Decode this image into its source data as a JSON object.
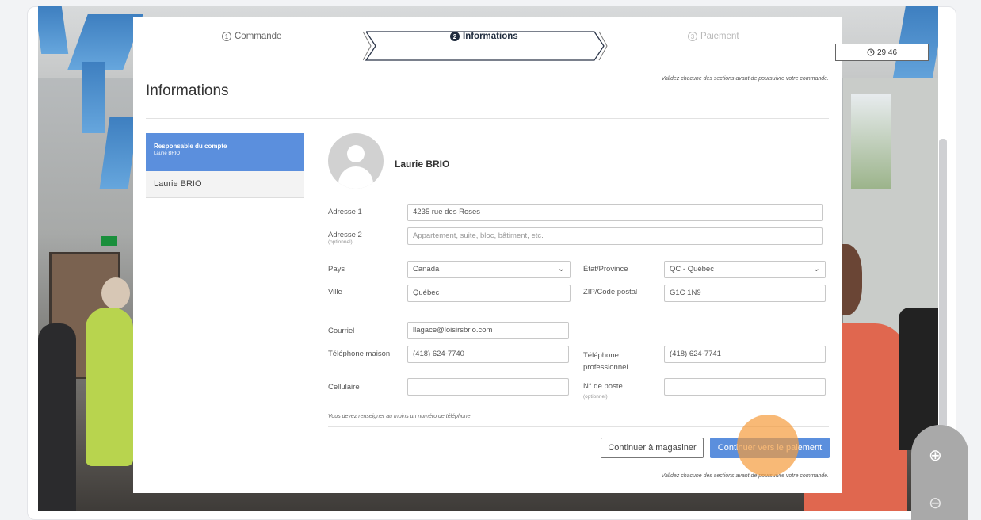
{
  "steps": [
    {
      "num": "1",
      "label": "Commande"
    },
    {
      "num": "2",
      "label": "Informations"
    },
    {
      "num": "3",
      "label": "Paiement"
    }
  ],
  "timer": {
    "icon": "clock-icon",
    "value": "29:46"
  },
  "hint_top": "Validez chacune des sections avant de poursuivre votre commande.",
  "hint_bottom": "Validez chacune des sections avant de poursuivre votre commande.",
  "page_title": "Informations",
  "sidebar": {
    "active_title": "Responsable du compte",
    "active_sub": "Laurie BRIO",
    "item": "Laurie BRIO"
  },
  "profile": {
    "name": "Laurie BRIO"
  },
  "form": {
    "adresse1_label": "Adresse 1",
    "adresse1_value": "4235 rue des Roses",
    "adresse2_label": "Adresse 2",
    "adresse2_optional": "(optionnel)",
    "adresse2_placeholder": "Appartement, suite, bloc, bâtiment, etc.",
    "pays_label": "Pays",
    "pays_value": "Canada",
    "etat_label": "État/Province",
    "etat_value": "QC - Québec",
    "ville_label": "Ville",
    "ville_value": "Québec",
    "zip_label": "ZIP/Code postal",
    "zip_value": "G1C 1N9",
    "courriel_label": "Courriel",
    "courriel_value": "llagace@loisirsbrio.com",
    "tel_maison_label": "Téléphone maison",
    "tel_maison_value": "(418) 624-7740",
    "tel_pro_label": "Téléphone professionnel",
    "tel_pro_value": "(418) 624-7741",
    "cellulaire_label": "Cellulaire",
    "cellulaire_value": "",
    "poste_label": "N° de poste",
    "poste_optional": "(optionnel)",
    "poste_value": "",
    "note": "Vous devez renseigner au moins un numéro de téléphone"
  },
  "buttons": {
    "continue_shopping": "Continuer à magasiner",
    "continue_payment": "Continuer vers le paiement"
  },
  "zoom": {
    "in": "⊕",
    "out": "⊖"
  }
}
